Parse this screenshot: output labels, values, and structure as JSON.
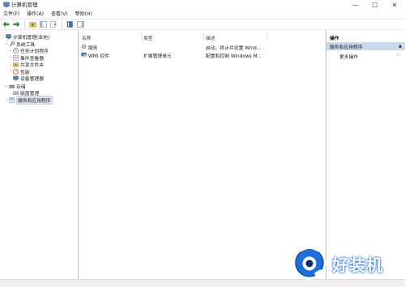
{
  "window": {
    "title": "计算机管理",
    "minimize": "—",
    "maximize": "☐",
    "close": "✕"
  },
  "menu": [
    "文件(F)",
    "操作(A)",
    "查看(V)",
    "帮助(H)"
  ],
  "tree": {
    "root": "计算机管理(本地)",
    "system_tools": "系统工具",
    "task_scheduler": "任务计划程序",
    "event_viewer": "事件查看器",
    "shared_folders": "共享文件夹",
    "performance": "性能",
    "device_manager": "设备管理器",
    "storage": "存储",
    "disk_management": "磁盘管理",
    "services_apps": "服务和应用程序"
  },
  "list": {
    "headers": {
      "name": "名称",
      "type": "类型",
      "desc": "描述"
    },
    "rows": [
      {
        "name": "服务",
        "type": "",
        "desc": "启动、终止并设置 Wind..."
      },
      {
        "name": "WMI 控件",
        "type": "扩展管理单元",
        "desc": "配置和控制 Windows M..."
      }
    ]
  },
  "actions": {
    "header": "操作",
    "section": "服务和应用程序",
    "more": "更多操作"
  },
  "watermark": {
    "text": "好装机"
  },
  "colors": {
    "selection": "#dbe3ee",
    "action_section": "#c9d9ec",
    "watermark_blue": "#1e6fd9"
  }
}
